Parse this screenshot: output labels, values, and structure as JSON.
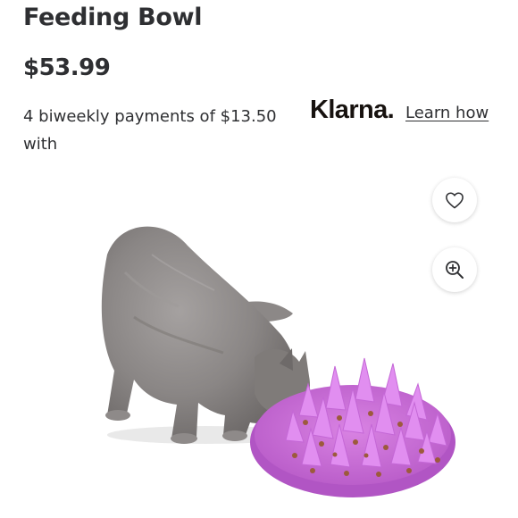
{
  "product": {
    "title": "Feeding Bowl",
    "price": "$53.99"
  },
  "financing": {
    "text": "4 biweekly payments of $13.50 with",
    "provider": "Klarna.",
    "learn_label": "Learn how"
  },
  "actions": {
    "favorite_icon": "heart-icon",
    "zoom_icon": "zoom-in-icon"
  },
  "image": {
    "subject": "gray cat eating from purple slow-feeder bowl",
    "bowl_color": "#c96fd8"
  }
}
